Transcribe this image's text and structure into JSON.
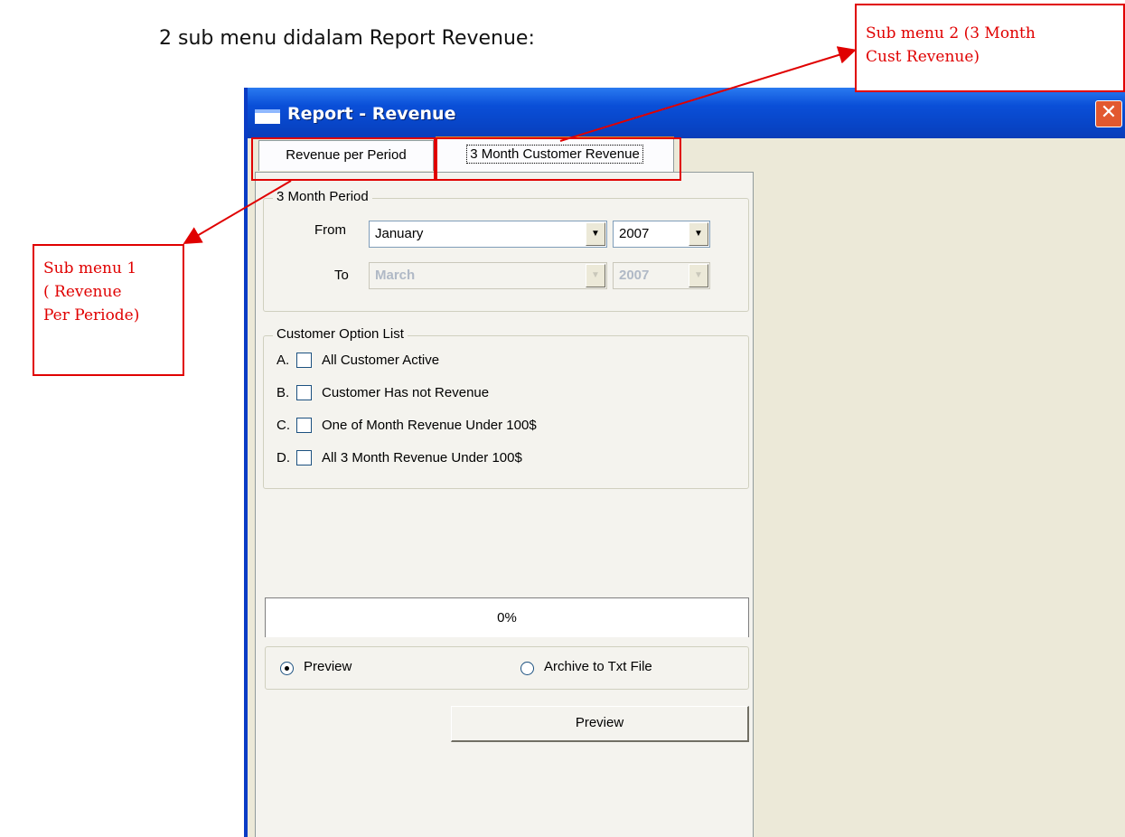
{
  "caption": "2 sub menu didalam Report Revenue:",
  "window": {
    "title": "Report - Revenue",
    "close_icon": "close-icon"
  },
  "tabs": [
    {
      "label": "Revenue per Period"
    },
    {
      "label": "3 Month Customer Revenue",
      "selected": true
    }
  ],
  "period_group": {
    "legend": "3 Month Period",
    "from_label": "From",
    "to_label": "To",
    "from_month": "January",
    "from_year": "2007",
    "to_month": "March",
    "to_year": "2007"
  },
  "customer_group": {
    "legend": "Customer Option List",
    "options": [
      {
        "letter": "A.",
        "label": "All Customer Active",
        "checked": false
      },
      {
        "letter": "B.",
        "label": "Customer Has not Revenue",
        "checked": false
      },
      {
        "letter": "C.",
        "label": "One of Month Revenue Under 100$",
        "checked": false
      },
      {
        "letter": "D.",
        "label": "All 3 Month Revenue Under 100$",
        "checked": false
      }
    ]
  },
  "progress": {
    "text": "0%",
    "value": 0
  },
  "output": {
    "preview_label": "Preview",
    "archive_label": "Archive to Txt File",
    "selected": "Preview"
  },
  "preview_button": "Preview",
  "callouts": {
    "sub1": [
      "Sub menu 1",
      "( Revenue",
      "Per Periode)"
    ],
    "sub2": [
      "Sub menu 2 (3 Month",
      "Cust Revenue)"
    ]
  },
  "colors": {
    "annotation": "#e00000",
    "titlebar": "#0a4fd8",
    "window_bg": "#ece9d8"
  }
}
